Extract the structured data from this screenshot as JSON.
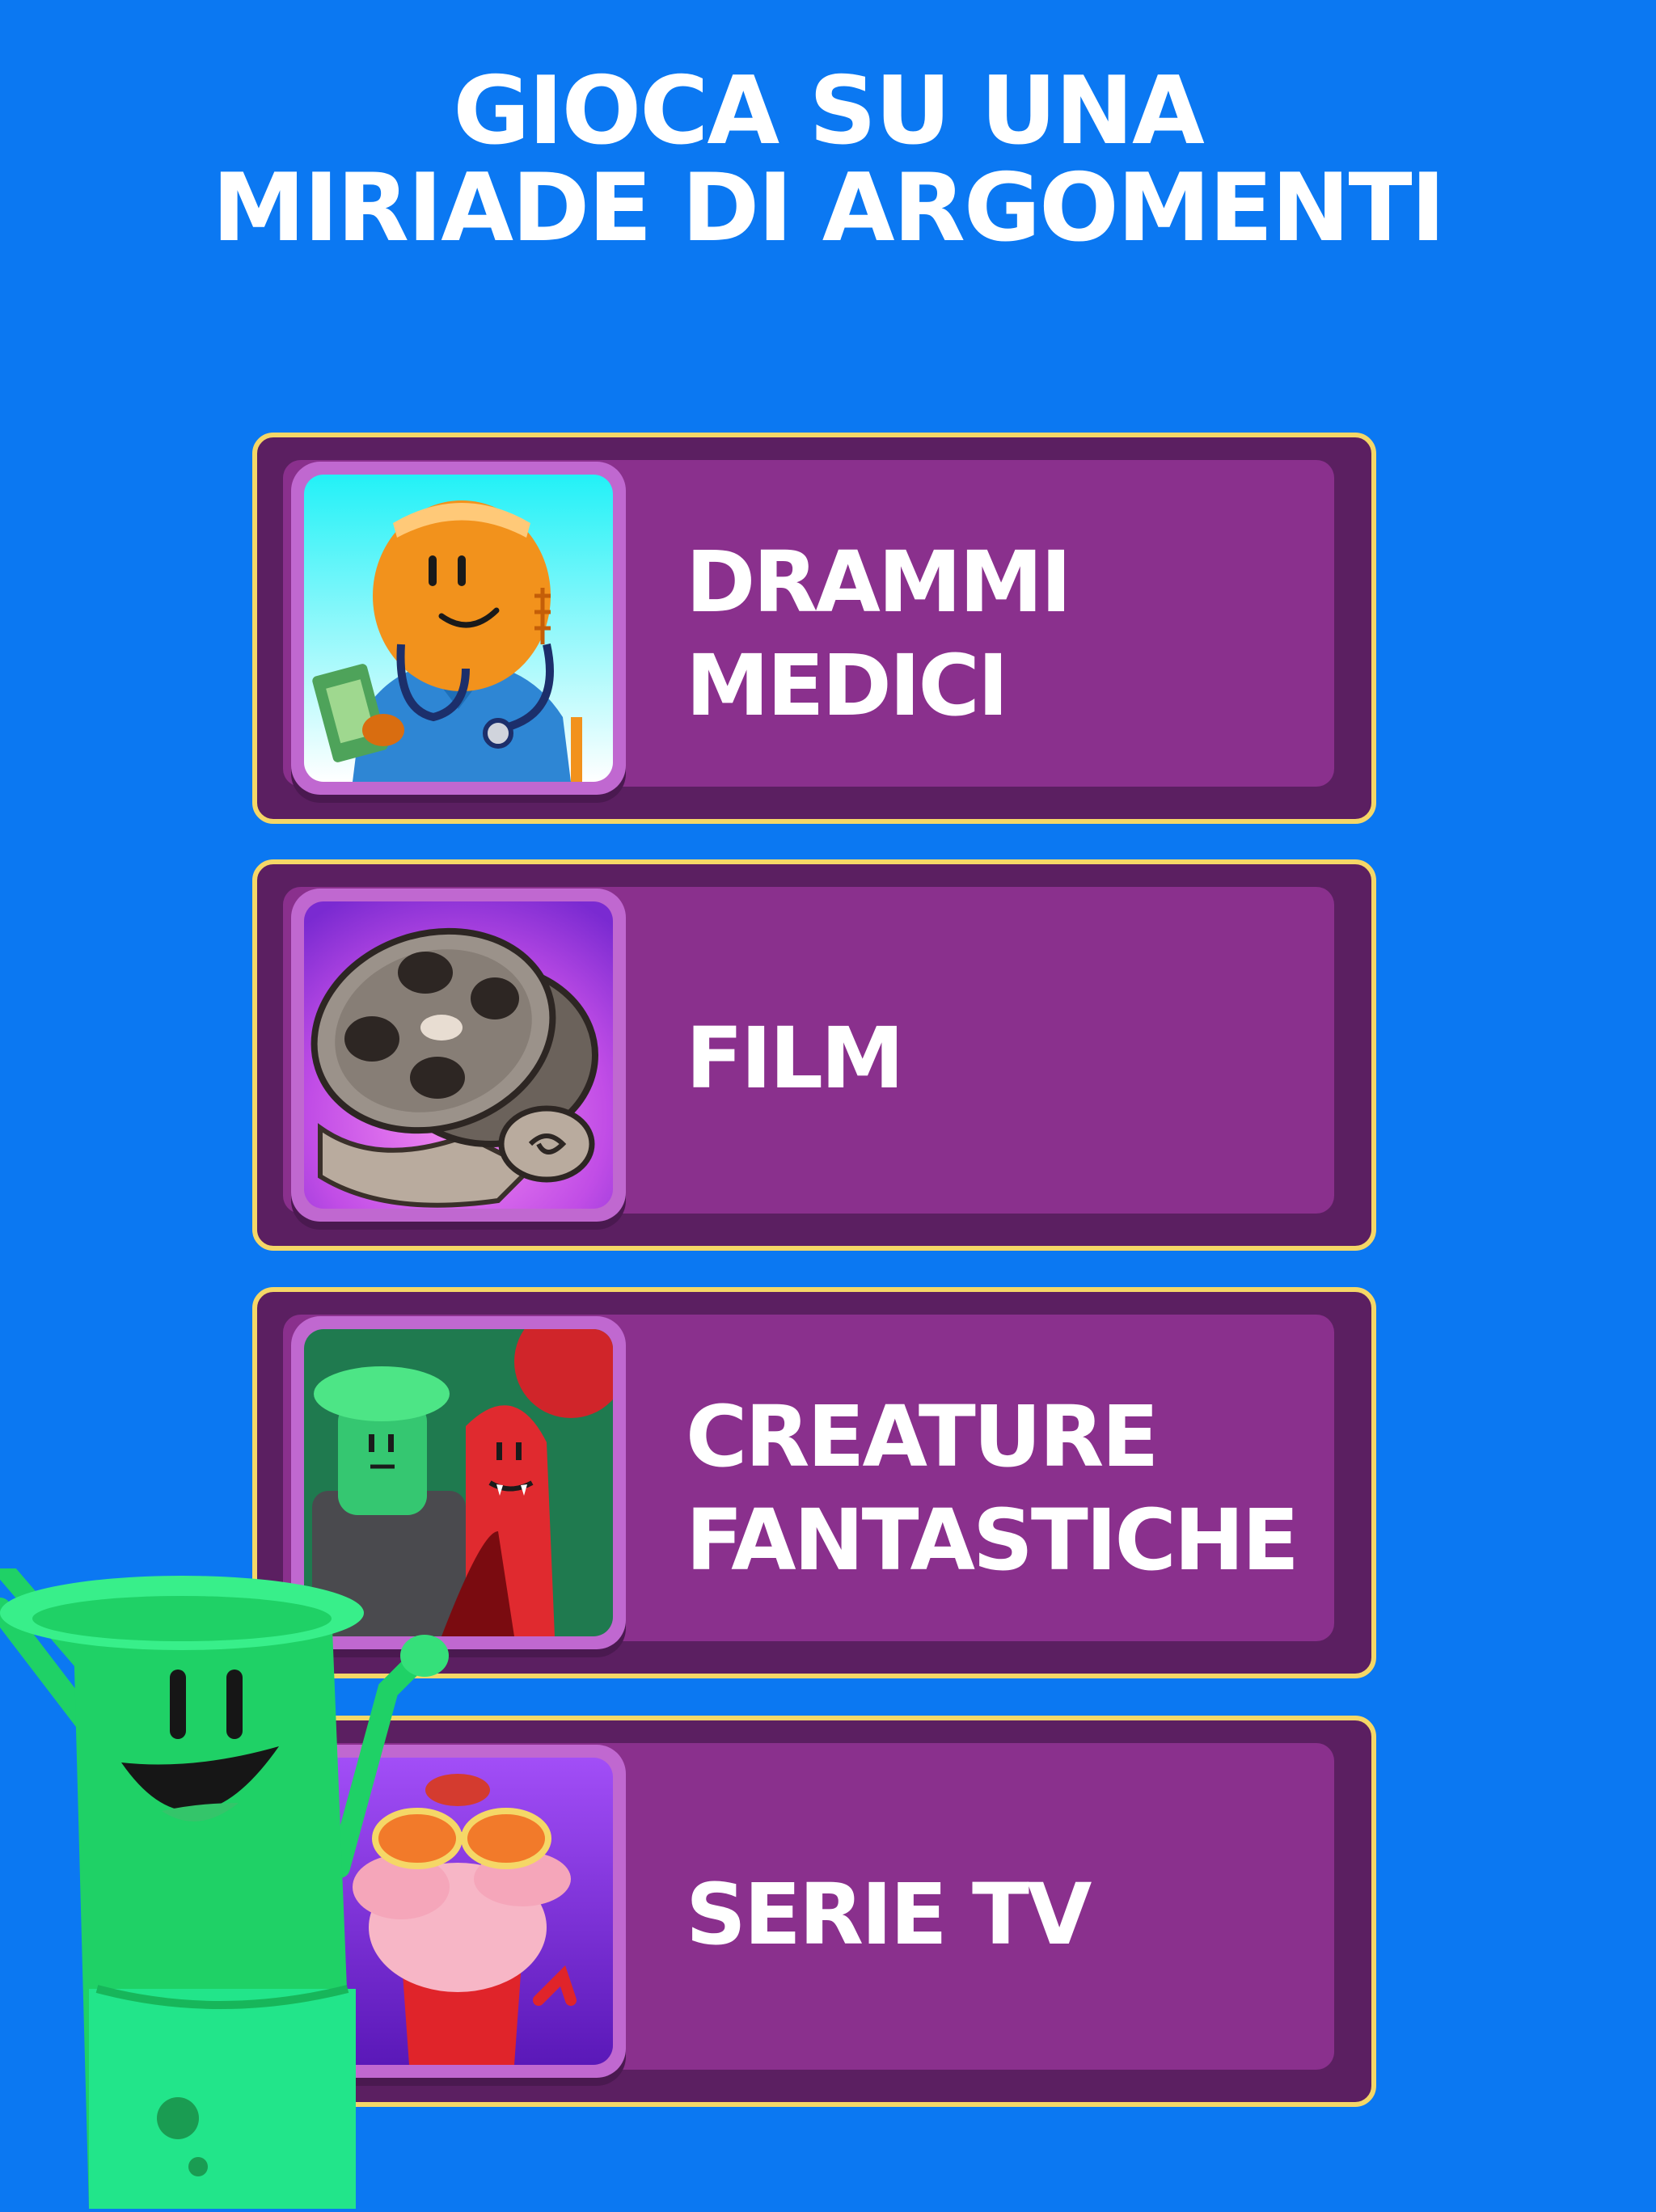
{
  "headline": {
    "line1": "GIOCA SU UNA",
    "line2": "MIRIADE DI ARGOMENTI"
  },
  "categories": [
    {
      "line1": "DRAMMI",
      "line2": "MEDICI",
      "icon": "medical-doctor-icon"
    },
    {
      "line1": "FILM",
      "line2": "",
      "icon": "film-reel-icon"
    },
    {
      "line1": "CREATURE",
      "line2": "FANTASTICHE",
      "icon": "fantasy-creatures-icon"
    },
    {
      "line1": "SERIE TV",
      "line2": "",
      "icon": "tv-series-icon"
    }
  ],
  "colors": {
    "background": "#0b78f2",
    "card_border": "#f5d767",
    "card_dark": "#5b1f61",
    "card_inner": "#8a308d",
    "thumb_frame": "#c068d0",
    "mascot_green": "#22dd66"
  }
}
